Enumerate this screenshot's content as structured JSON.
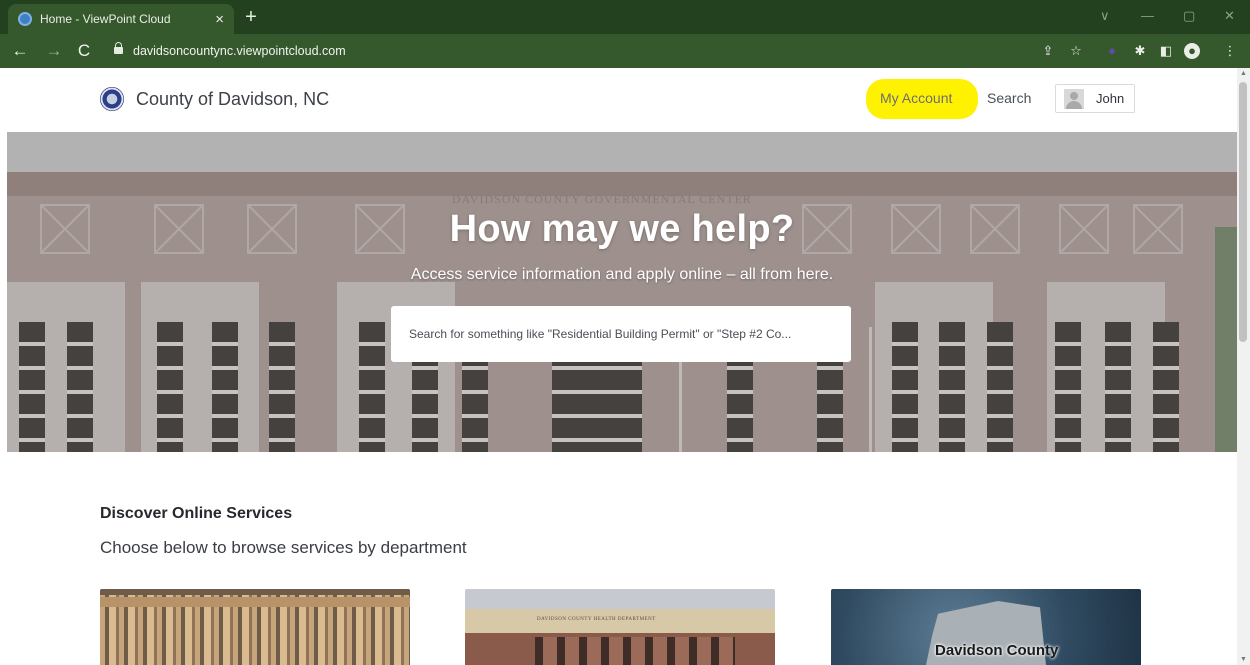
{
  "browser": {
    "tab_title": "Home - ViewPoint Cloud",
    "tab_close": "×",
    "new_tab": "+",
    "url": "davidsoncountync.viewpointcloud.com",
    "window_controls": [
      "∨",
      "—",
      "▢",
      "✕"
    ]
  },
  "site": {
    "title": "County of Davidson, NC",
    "nav": {
      "my_account": "My Account",
      "search": "Search",
      "user_name": "John"
    }
  },
  "hero": {
    "building_sign": "DAVIDSON COUNTY GOVERNMENTAL CENTER",
    "heading": "How may we help?",
    "subheading": "Access service information and apply online – all from here.",
    "search_placeholder": "Search for something like \"Residential Building Permit\" or \"Step #2 Co..."
  },
  "discover": {
    "title": "Discover Online Services",
    "subtitle": "Choose below to browse services by department",
    "cards": [
      {
        "id": "building"
      },
      {
        "id": "health",
        "sign": "DAVIDSON COUNTY HEALTH DEPARTMENT"
      },
      {
        "id": "map",
        "label": "Davidson County"
      }
    ]
  },
  "colors": {
    "browser_frame": "#23411e",
    "browser_toolbar": "#35582c",
    "highlight": "#fff200"
  }
}
